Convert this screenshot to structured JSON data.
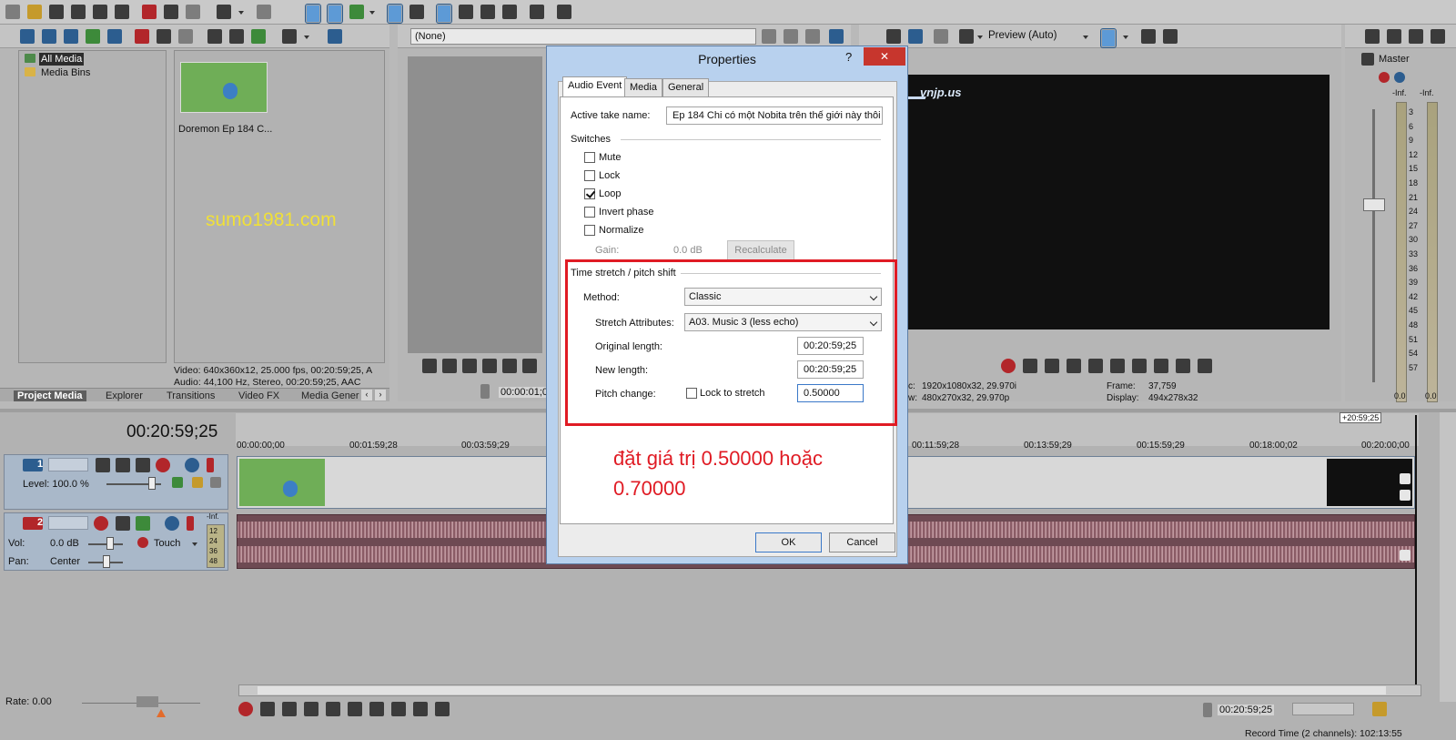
{
  "project_media": {
    "tree_items": [
      "All Media",
      "Media Bins"
    ],
    "thumbnail_caption": "Doremon Ep 184 C...",
    "info_video": "Video: 640x360x12, 25.000 fps, 00:20:59;25, A",
    "info_audio": "Audio: 44,100 Hz, Stereo, 00:20:59;25, AAC",
    "tabs": [
      "Project Media",
      "Explorer",
      "Transitions",
      "Video FX",
      "Media Gener"
    ]
  },
  "trimmer": {
    "dropdown": "(None)",
    "time": "00:00:01;0"
  },
  "preview": {
    "mode": "Preview (Auto)",
    "project_label": "c:",
    "project_value": "1920x1080x32, 29.970i",
    "preview_label": "w:",
    "preview_value": "480x270x32, 29.970p",
    "frame_label": "Frame:",
    "frame_value": "37,759",
    "display_label": "Display:",
    "display_value": "494x278x32"
  },
  "master": {
    "title": "Master",
    "inf_left": "-Inf.",
    "inf_right": "-Inf.",
    "scale": [
      "3",
      "6",
      "9",
      "12",
      "15",
      "18",
      "21",
      "24",
      "27",
      "30",
      "33",
      "36",
      "39",
      "42",
      "45",
      "48",
      "51",
      "54",
      "57"
    ],
    "bottom_left": "0.0",
    "bottom_right": "0.0"
  },
  "dialog": {
    "title": "Properties",
    "help": "?",
    "close": "✕",
    "tabs": [
      "Audio Event",
      "Media",
      "General"
    ],
    "active_take_label": "Active take name:",
    "active_take_value": "Ep 184 Chi có một Nobita trên thế giới này thôi",
    "switches_label": "Switches",
    "mute": "Mute",
    "lock": "Lock",
    "loop": "Loop",
    "invert_phase": "Invert phase",
    "normalize": "Normalize",
    "gain_label": "Gain:",
    "gain_value": "0.0 dB",
    "recalculate": "Recalculate",
    "stretch_section": "Time stretch / pitch shift",
    "method_label": "Method:",
    "method_value": "Classic",
    "attributes_label": "Stretch Attributes:",
    "attributes_value": "A03. Music 3 (less echo)",
    "original_label": "Original length:",
    "original_value": "00:20:59;25",
    "new_label": "New length:",
    "new_value": "00:20:59;25",
    "pitch_label": "Pitch change:",
    "lock_stretch": "Lock to stretch",
    "pitch_value": "0.50000",
    "ok": "OK",
    "cancel": "Cancel"
  },
  "annotation": {
    "watermark": "sumo1981.com",
    "note": "đặt giá trị 0.50000 hoặc 0.70000"
  },
  "timeline": {
    "cursor_time": "00:20:59;25",
    "end_badge": "+20:59;25",
    "ruler": [
      "00:00:00;00",
      "00:01:59;28",
      "00:03:59;29",
      "00:11:59;28",
      "00:13:59;29",
      "00:15:59;29",
      "00:18:00;02",
      "00:20:00;00"
    ],
    "video_track_number": "1",
    "video_level": "Level: 100.0 %",
    "audio_track_number": "2",
    "vol_label": "Vol:",
    "vol_value": "0.0 dB",
    "pan_label": "Pan:",
    "pan_value": "Center",
    "touch": "Touch",
    "meter_inf": "-Inf.",
    "meter_scale": [
      "12",
      "24",
      "36",
      "48"
    ],
    "rate": "Rate: 0.00",
    "transport_time": "00:20:59;25",
    "record_time": "Record Time (2 channels): 102:13:55"
  }
}
